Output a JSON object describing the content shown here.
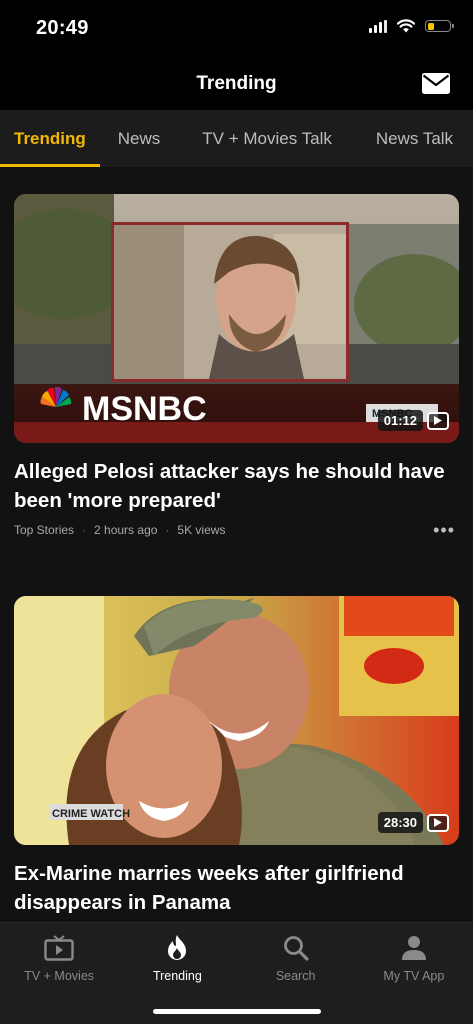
{
  "status_bar": {
    "time": "20:49",
    "battery_level": 0.25,
    "icons": [
      "cellular-signal-icon",
      "wifi-icon",
      "battery-icon"
    ]
  },
  "header": {
    "title": "Trending",
    "mail_icon": "mail-icon"
  },
  "tabs": [
    {
      "label": "Trending",
      "active": true
    },
    {
      "label": "News",
      "active": false
    },
    {
      "label": "TV + Movies Talk",
      "active": false
    },
    {
      "label": "News Talk",
      "active": false
    }
  ],
  "accent_color": "#f2b705",
  "cards": [
    {
      "title": "Alleged Pelosi attacker says he should have been 'more prepared'",
      "duration": "01:12",
      "logo_text": "MSNBC",
      "category": "Top Stories",
      "time_ago": "2 hours ago",
      "views": "5K views",
      "more": "•••"
    },
    {
      "title": "Ex-Marine marries weeks after girlfriend disappears in Panama",
      "duration": "28:30",
      "logo_text": "CRIME WATCH"
    }
  ],
  "bottom_nav": [
    {
      "label": "TV + Movies",
      "icon": "tv-icon",
      "active": false
    },
    {
      "label": "Trending",
      "icon": "flame-icon",
      "active": true
    },
    {
      "label": "Search",
      "icon": "search-icon",
      "active": false
    },
    {
      "label": "My TV App",
      "icon": "user-icon",
      "active": false
    }
  ]
}
